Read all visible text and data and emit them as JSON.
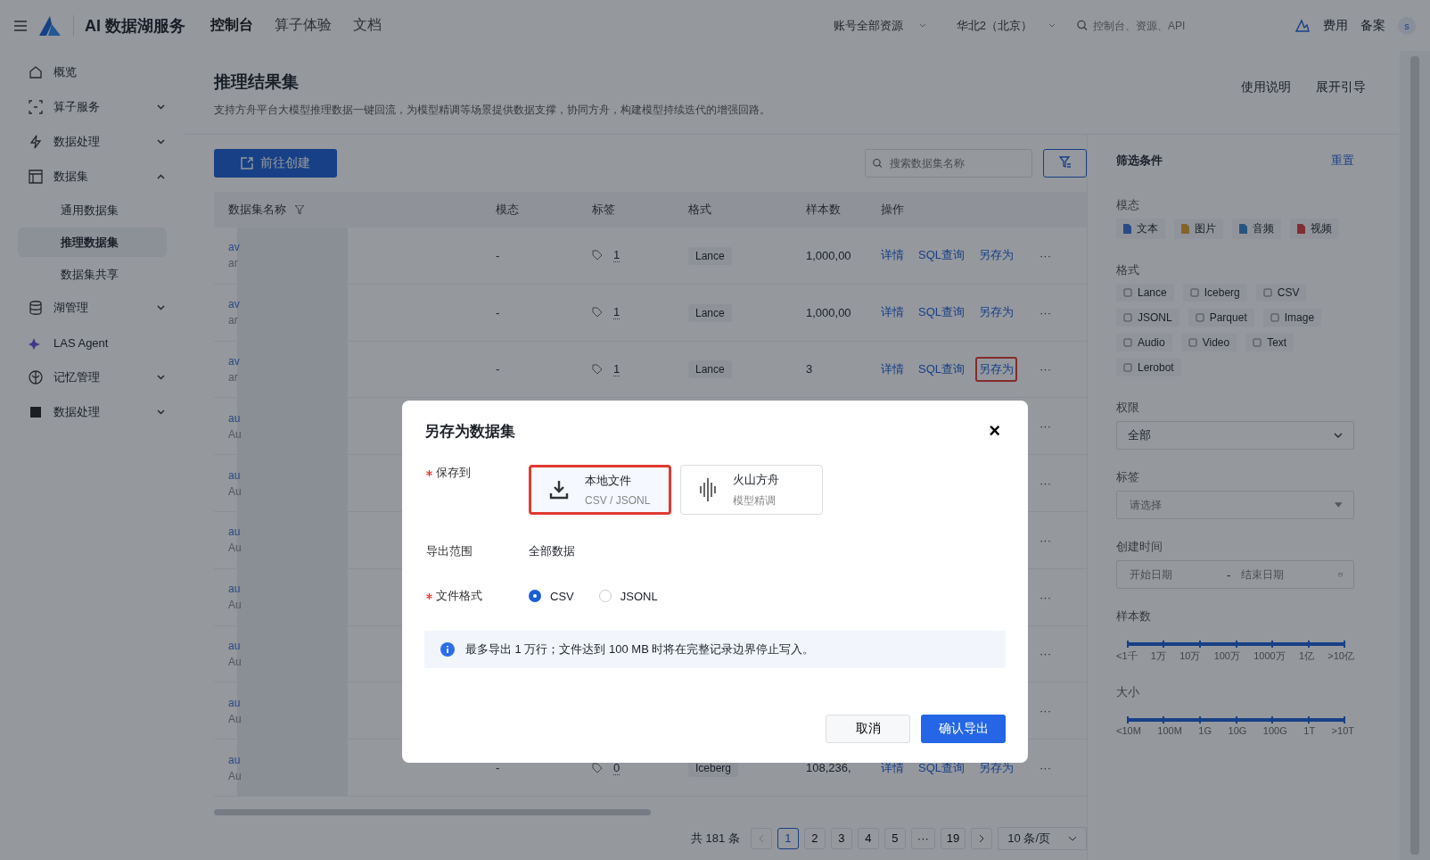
{
  "topbar": {
    "product": "AI 数据湖服务",
    "nav": [
      {
        "label": "控制台",
        "selected": true
      },
      {
        "label": "算子体验",
        "selected": false
      },
      {
        "label": "文档",
        "selected": false
      }
    ],
    "account_select": "账号全部资源",
    "region_select": "华北2（北京）",
    "search": {
      "placeholder": "控制台、资源、API"
    },
    "links": [
      "费用",
      "备案"
    ],
    "avatar": "s"
  },
  "sidebar": {
    "items": [
      {
        "label": "概览"
      },
      {
        "label": "算子服务",
        "expanded": false
      },
      {
        "label": "数据处理",
        "expanded": false
      },
      {
        "label": "数据集",
        "expanded": true,
        "children": [
          {
            "label": "通用数据集",
            "selected": false
          },
          {
            "label": "推理数据集",
            "selected": true
          },
          {
            "label": "数据集共享",
            "selected": false
          }
        ]
      },
      {
        "label": "湖管理",
        "expanded": false
      },
      {
        "label": "LAS Agent"
      },
      {
        "label": "记忆管理",
        "expanded": false
      },
      {
        "label": "数据处理",
        "expanded": false
      }
    ]
  },
  "header": {
    "title": "推理结果集",
    "description": "支持方舟平台大模型推理数据一键回流，为模型精调等场景提供数据支撑，协同方舟，构建模型持续迭代的增强回路。",
    "links": [
      "使用说明",
      "展开引导"
    ]
  },
  "toolbar": {
    "create_button": "前往创建",
    "search": {
      "placeholder": "搜索数据集名称"
    }
  },
  "table": {
    "columns": [
      "数据集名称",
      "模态",
      "标签",
      "格式",
      "样本数",
      "操作"
    ],
    "rows": [
      {
        "name_1": "av",
        "name_2": "ar",
        "modality": "-",
        "tags": "1",
        "format": "Lance",
        "samples": "1,000,00",
        "actions": [
          "详情",
          "SQL查询",
          "另存为"
        ],
        "save_as_highlighted": false,
        "more": "···"
      },
      {
        "name_1": "av",
        "name_2": "ar",
        "modality": "-",
        "tags": "1",
        "format": "Lance",
        "samples": "1,000,00",
        "actions": [
          "详情",
          "SQL查询",
          "另存为"
        ],
        "save_as_highlighted": false,
        "more": "···"
      },
      {
        "name_1": "av",
        "name_2": "ar",
        "modality": "-",
        "tags": "1",
        "format": "Lance",
        "samples": "3",
        "actions": [
          "详情",
          "SQL查询",
          "另存为"
        ],
        "save_as_highlighted": true,
        "more": "···"
      },
      {
        "name_1": "au",
        "name_2": "Au",
        "more": "···"
      },
      {
        "name_1": "au",
        "name_2": "Au",
        "more": "···"
      },
      {
        "name_1": "au",
        "name_2": "Au",
        "more": "···"
      },
      {
        "name_1": "au",
        "name_2": "Au",
        "more": "···"
      },
      {
        "name_1": "au",
        "name_2": "Au",
        "more": "···"
      },
      {
        "name_1": "au",
        "name_2": "Au",
        "more": "···"
      },
      {
        "name_1": "au",
        "name_2": "Au",
        "modality": "-",
        "tags": "0",
        "format": "Iceberg",
        "samples": "108,236,",
        "actions": [
          "详情",
          "SQL查询",
          "另存为"
        ],
        "save_as_highlighted": false,
        "more": "···"
      }
    ]
  },
  "pagination": {
    "total": "共 181 条",
    "pages": [
      {
        "label": "1",
        "selected": true
      },
      {
        "label": "2",
        "selected": false
      },
      {
        "label": "3",
        "selected": false
      },
      {
        "label": "4",
        "selected": false
      },
      {
        "label": "5",
        "selected": false
      },
      {
        "label": "···",
        "selected": false
      },
      {
        "label": "19",
        "selected": false
      }
    ],
    "page_size": "10 条/页"
  },
  "filters": {
    "title": "筛选条件",
    "reset": "重置",
    "modality": {
      "label": "模态",
      "chips": [
        "文本",
        "图片",
        "音频",
        "视频"
      ]
    },
    "format": {
      "label": "格式",
      "chips": [
        "Lance",
        "Iceberg",
        "CSV",
        "JSONL",
        "Parquet",
        "Image",
        "Audio",
        "Video",
        "Text",
        "Lerobot"
      ]
    },
    "permission": {
      "label": "权限",
      "value": "全部"
    },
    "tags": {
      "label": "标签",
      "placeholder": "请选择"
    },
    "created": {
      "label": "创建时间",
      "start_placeholder": "开始日期",
      "separator": "-",
      "end_placeholder": "结束日期"
    },
    "sample_count": {
      "label": "样本数",
      "level": 1,
      "ticks": [
        "<1千",
        "1万",
        "10万",
        "100万",
        "1000万",
        "1亿",
        ">10亿"
      ]
    },
    "size": {
      "label": "大小",
      "level": 1,
      "ticks": [
        "<10M",
        "100M",
        "1G",
        "10G",
        "100G",
        "1T",
        ">10T"
      ]
    }
  },
  "dialog": {
    "title": "另存为数据集",
    "close": "×",
    "save_to": {
      "label": "保存到",
      "required": true,
      "options": [
        {
          "title": "本地文件",
          "subtitle": "CSV / JSONL",
          "selected": true
        },
        {
          "title": "火山方舟",
          "subtitle": "模型精调",
          "selected": false
        }
      ]
    },
    "scope": {
      "label": "导出范围",
      "required": false,
      "value": "全部数据"
    },
    "file_format": {
      "label": "文件格式",
      "required": true,
      "options": [
        {
          "label": "CSV",
          "selected": true
        },
        {
          "label": "JSONL",
          "selected": false
        }
      ]
    },
    "notice": "最多导出 1 万行；文件达到 100 MB 时将在完整记录边界停止写入。",
    "buttons": [
      {
        "label": "取消",
        "kind": "secondary"
      },
      {
        "label": "确认导出",
        "kind": "primary"
      }
    ]
  }
}
